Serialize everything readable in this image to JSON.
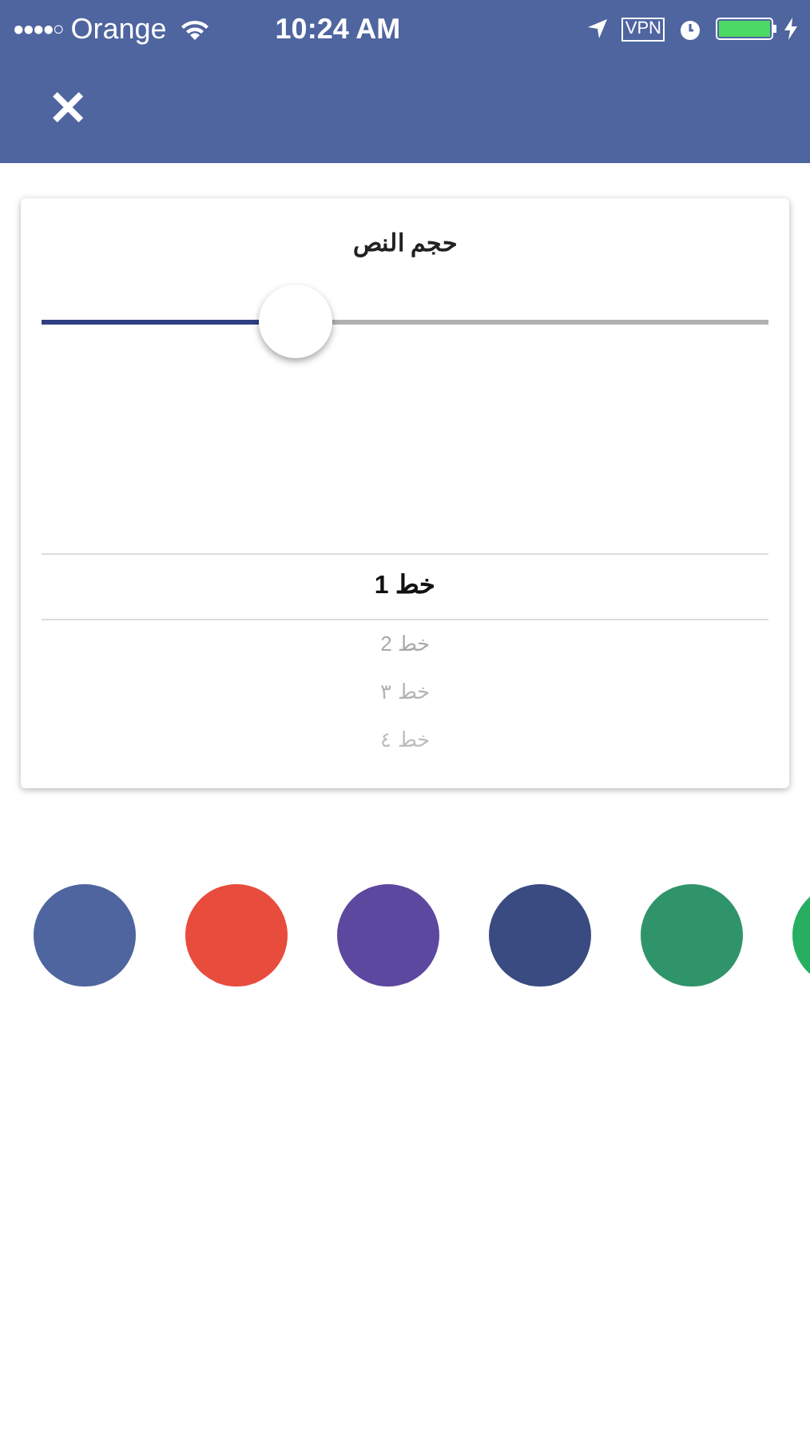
{
  "status_bar": {
    "signal_bars": "●●●●○",
    "carrier": "Orange",
    "time": "10:24 AM",
    "vpn": "VPN"
  },
  "nav_bar": {
    "close": "✕"
  },
  "card": {
    "title": "حجم النص",
    "slider": {
      "level": 0.35
    },
    "picker": [
      {
        "label": "خط 1",
        "selected": true
      },
      {
        "label": "خط 2",
        "selected": false
      },
      {
        "label": "خط ٣",
        "selected": false
      },
      {
        "label": "خط ٤",
        "selected": false
      }
    ]
  },
  "colors": [
    {
      "color": "#4f65a0",
      "selected": false
    },
    {
      "color": "#e84c3d",
      "selected": false
    },
    {
      "color": "#5d48a0",
      "selected": false
    },
    {
      "color": "#394b80",
      "selected": false
    },
    {
      "color": "#30946a",
      "selected": false
    },
    {
      "color": "#27ae60",
      "selected": false
    }
  ]
}
